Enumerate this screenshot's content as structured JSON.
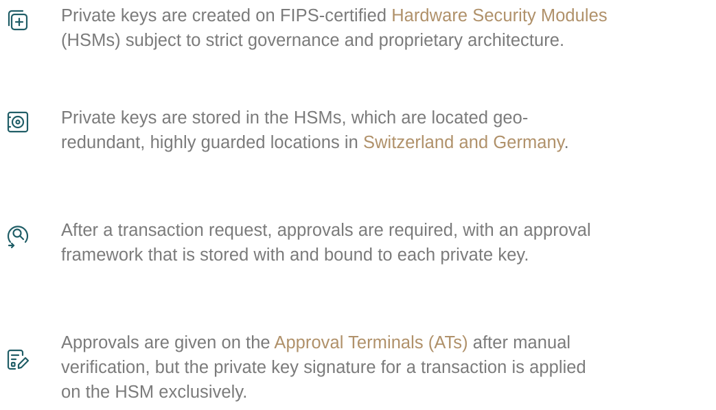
{
  "features": [
    {
      "icon": "add-key-icon",
      "lines": [
        {
          "before": "Private keys are created on FIPS-certified ",
          "link": "Hardware Security Modules",
          "after": ""
        },
        {
          "before": "(HSMs) subject to strict governance and proprietary architecture.",
          "link": "",
          "after": ""
        }
      ]
    },
    {
      "icon": "vault-icon",
      "lines": [
        {
          "before": "Private keys are stored in the HSMs, which are located geo-",
          "link": "",
          "after": ""
        },
        {
          "before": "redundant, highly guarded locations in ",
          "link": "Switzerland and Germany",
          "after": "."
        }
      ]
    },
    {
      "icon": "search-approval-icon",
      "lines": [
        {
          "before": "After a transaction request, approvals are required, with an approval",
          "link": "",
          "after": ""
        },
        {
          "before": "framework that is stored with and bound to each private key.",
          "link": "",
          "after": ""
        }
      ]
    },
    {
      "icon": "document-edit-icon",
      "lines": [
        {
          "before": "Approvals are given on the ",
          "link": "Approval Terminals (ATs)",
          "after": " after manual"
        },
        {
          "before": "verification, but the private key signature for a transaction is applied",
          "link": "",
          "after": ""
        },
        {
          "before": "on the HSM exclusively.",
          "link": "",
          "after": ""
        }
      ]
    }
  ]
}
